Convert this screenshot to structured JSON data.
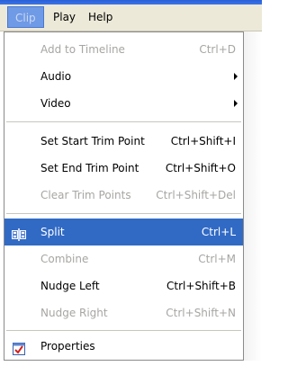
{
  "menubar": {
    "items": [
      {
        "label": "Clip"
      },
      {
        "label": "Play"
      },
      {
        "label": "Help"
      }
    ]
  },
  "menu": {
    "add_to_timeline": {
      "label": "Add to Timeline",
      "shortcut": "Ctrl+D"
    },
    "audio": {
      "label": "Audio"
    },
    "video": {
      "label": "Video"
    },
    "set_start_trim": {
      "label": "Set Start Trim Point",
      "shortcut": "Ctrl+Shift+I"
    },
    "set_end_trim": {
      "label": "Set End Trim Point",
      "shortcut": "Ctrl+Shift+O"
    },
    "clear_trim": {
      "label": "Clear Trim Points",
      "shortcut": "Ctrl+Shift+Del"
    },
    "split": {
      "label": "Split",
      "shortcut": "Ctrl+L"
    },
    "combine": {
      "label": "Combine",
      "shortcut": "Ctrl+M"
    },
    "nudge_left": {
      "label": "Nudge Left",
      "shortcut": "Ctrl+Shift+B"
    },
    "nudge_right": {
      "label": "Nudge Right",
      "shortcut": "Ctrl+Shift+N"
    },
    "properties": {
      "label": "Properties"
    }
  },
  "colors": {
    "highlight": "#316ac5",
    "disabled_text": "#a7a6a3",
    "menubar_bg": "#ece9d8"
  },
  "icons": {
    "split": "split-clip-icon",
    "properties": "properties-checkmark-icon",
    "submenu": "submenu-arrow-icon"
  }
}
